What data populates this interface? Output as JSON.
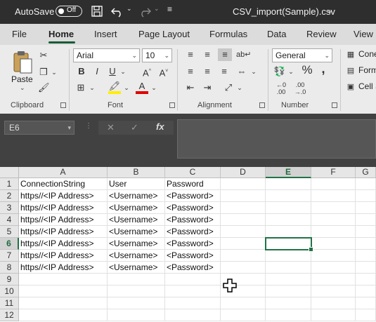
{
  "titlebar": {
    "autosave_label": "AutoSave",
    "autosave_state": "Off",
    "filename": "CSV_import(Sample).csv",
    "icons": [
      "save-icon",
      "undo-icon",
      "redo-icon",
      "customize-qat-icon"
    ]
  },
  "tabs": [
    "File",
    "Home",
    "Insert",
    "Page Layout",
    "Formulas",
    "Data",
    "Review",
    "View"
  ],
  "active_tab": "Home",
  "ribbon": {
    "clipboard": {
      "paste_label": "Paste",
      "group_label": "Clipboard"
    },
    "font": {
      "name": "Arial",
      "size": "10",
      "group_label": "Font",
      "bold": "B",
      "italic": "I",
      "underline": "U",
      "grow": "A^",
      "shrink": "A˅",
      "fill": "A",
      "fontcolor": "A"
    },
    "alignment": {
      "group_label": "Alignment"
    },
    "number": {
      "format": "General",
      "percent": "%",
      "comma": ",",
      "group_label": "Number",
      "inc_dec": ".0 .00",
      "dec_dec": ".00 .0"
    },
    "styles": {
      "items": [
        "Conditional Formatting",
        "Format as Table",
        "Cell Styles"
      ],
      "visible_items": [
        "Cone",
        "Form",
        "Cell S"
      ]
    }
  },
  "formula_bar": {
    "name_box": "E6",
    "cancel": "✕",
    "enter": "✓",
    "fx": "fx",
    "content": ""
  },
  "sheet": {
    "columns": [
      "A",
      "B",
      "C",
      "D",
      "E",
      "F",
      "G"
    ],
    "selected_column": "E",
    "selected_row": "6",
    "selected_cell": "E6",
    "rows": [
      "1",
      "2",
      "3",
      "4",
      "5",
      "6",
      "7",
      "8",
      "9",
      "10",
      "11",
      "12"
    ],
    "data": [
      [
        "ConnectionString",
        "User",
        "Password"
      ],
      [
        "https//<IP Address>",
        "<Username>",
        "<Password>"
      ],
      [
        "https//<IP Address>",
        "<Username>",
        "<Password>"
      ],
      [
        "https//<IP Address>",
        "<Username>",
        "<Password>"
      ],
      [
        "https//<IP Address>",
        "<Username>",
        "<Password>"
      ],
      [
        "https//<IP Address>",
        "<Username>",
        "<Password>"
      ],
      [
        "https//<IP Address>",
        "<Username>",
        "<Password>"
      ],
      [
        "https//<IP Address>",
        "<Username>",
        "<Password>"
      ]
    ]
  },
  "colors": {
    "accent": "#217346",
    "titlebar": "#2e2e2e",
    "ribbon": "#ebebeb"
  }
}
